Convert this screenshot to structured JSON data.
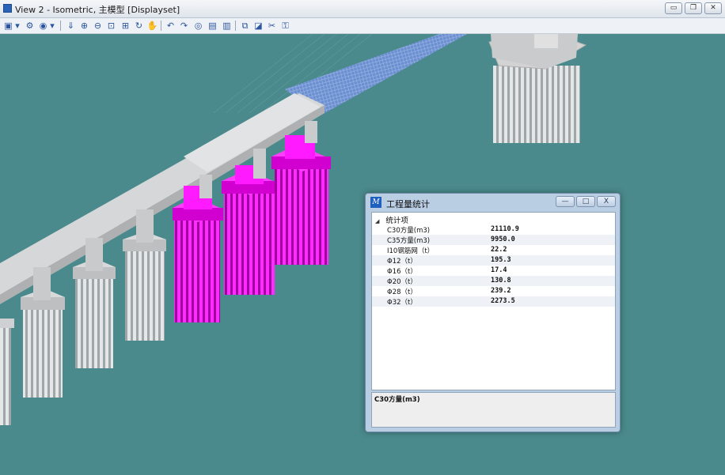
{
  "window": {
    "title": "View 2 - Isometric, 主模型 [Displayset]",
    "minimize_glyph": "▭",
    "restore_glyph": "❐",
    "close_glyph": "✕"
  },
  "toolbar": {
    "icons": [
      "view-attributes-icon",
      "dropdown-icon",
      "view-settings-icon",
      "render-icon",
      "dropdown-icon",
      "pan-icon",
      "zoom-in-icon",
      "zoom-out-icon",
      "zoom-window-icon",
      "fit-view-icon",
      "rotate-view-icon",
      "hand-pan-icon",
      "previous-view-icon",
      "next-view-icon",
      "camera-icon",
      "clip-volume-icon",
      "clip-mask-icon",
      "copy-view-icon",
      "view-toggle-icon",
      "section-icon",
      "lock-icon"
    ]
  },
  "colors": {
    "background": "#4a8a8c",
    "highlight": "#ff00ff",
    "concrete": "#d9d9d9",
    "deck_mesh": "#5b7fd0"
  },
  "dialog": {
    "title": "工程量统计",
    "min_glyph": "—",
    "max_glyph": "□",
    "close_glyph": "X",
    "header": "统计项",
    "items": [
      {
        "name": "C30方量(m3)",
        "value": "21110.9"
      },
      {
        "name": "C35方量(m3)",
        "value": "9950.0"
      },
      {
        "name": "I10钢筋网（t）",
        "value": "22.2"
      },
      {
        "name": "Φ12（t）",
        "value": "195.3"
      },
      {
        "name": "Φ16（t）",
        "value": "17.4"
      },
      {
        "name": "Φ20（t）",
        "value": "130.8"
      },
      {
        "name": "Φ28（t）",
        "value": "239.2"
      },
      {
        "name": "Φ32（t）",
        "value": "2273.5"
      }
    ],
    "description": "C30方量(m3)"
  }
}
